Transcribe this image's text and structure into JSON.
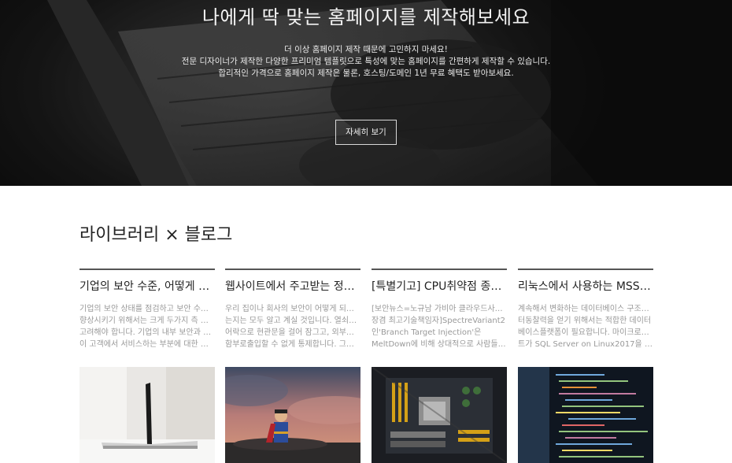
{
  "hero": {
    "title": "나에게 딱 맞는 홈페이지를 제작해보세요",
    "lines": [
      "더 이상 홈페이지 제작 때문에 고민하지 마세요!",
      "전문 디자이너가 제작한 다양한 프리미엄 템플릿으로 특성에 맞는 홈페이지를 간편하게 제작할 수 있습니다.",
      "합리적인 가격으로 홈페이지 제작은 물론, 호스팅/도메인 1년 무료 혜택도 받아보세요."
    ],
    "button_label": "자세히 보기"
  },
  "section": {
    "title": "라이브러리 × 블로그"
  },
  "posts": [
    {
      "title": "기업의 보안 수준, 어떻게 높…",
      "excerpt": [
        "기업의 보안 상태를 점검하고 보안 수준을",
        "향상시키기 위해서는 크게 두가지 측 고려",
        "고려해야 합니다. 기업의 내부 보안과 기업",
        "이 고객에서 서비스하는 부분에 대한 보…"
      ],
      "image": "laptop-on-desk-photo"
    },
    {
      "title": "웹사이트에서 주고받는 정보…",
      "excerpt": [
        "우리 집이나 회사의 보안이 어떻게 되고 있",
        "는지는 모두 알고 계실 것입니다. 열쇠나 도",
        "어락으로 현관문을 걸어 잠그고, 외부인이",
        "함부로출입할 수 없게 통제합니다. 그렇…"
      ],
      "image": "superhero-figure-photo"
    },
    {
      "title": "[특별기고] CPU취약점 종합…",
      "excerpt": [
        "[보안뉴스=노규남 가비아 클라우드사업부",
        "장겸 최고기술책임자]SpectreVariant2",
        "인'Branch Target Injection'은",
        "MeltDown에 비해 상대적으로 사람들이…"
      ],
      "image": "motherboard-photo"
    },
    {
      "title": "리눅스에서 사용하는 MSSQ…",
      "excerpt": [
        "계속해서 변화하는 데이터베이스 구조로부",
        "터동찰력을 얻기 위해서는 적합한 데이터",
        "베이스플랫폼이 필요합니다. 마이크로소프",
        "트가 SQL Server on Linux2017을 출…"
      ],
      "image": "code-screen-photo"
    }
  ]
}
